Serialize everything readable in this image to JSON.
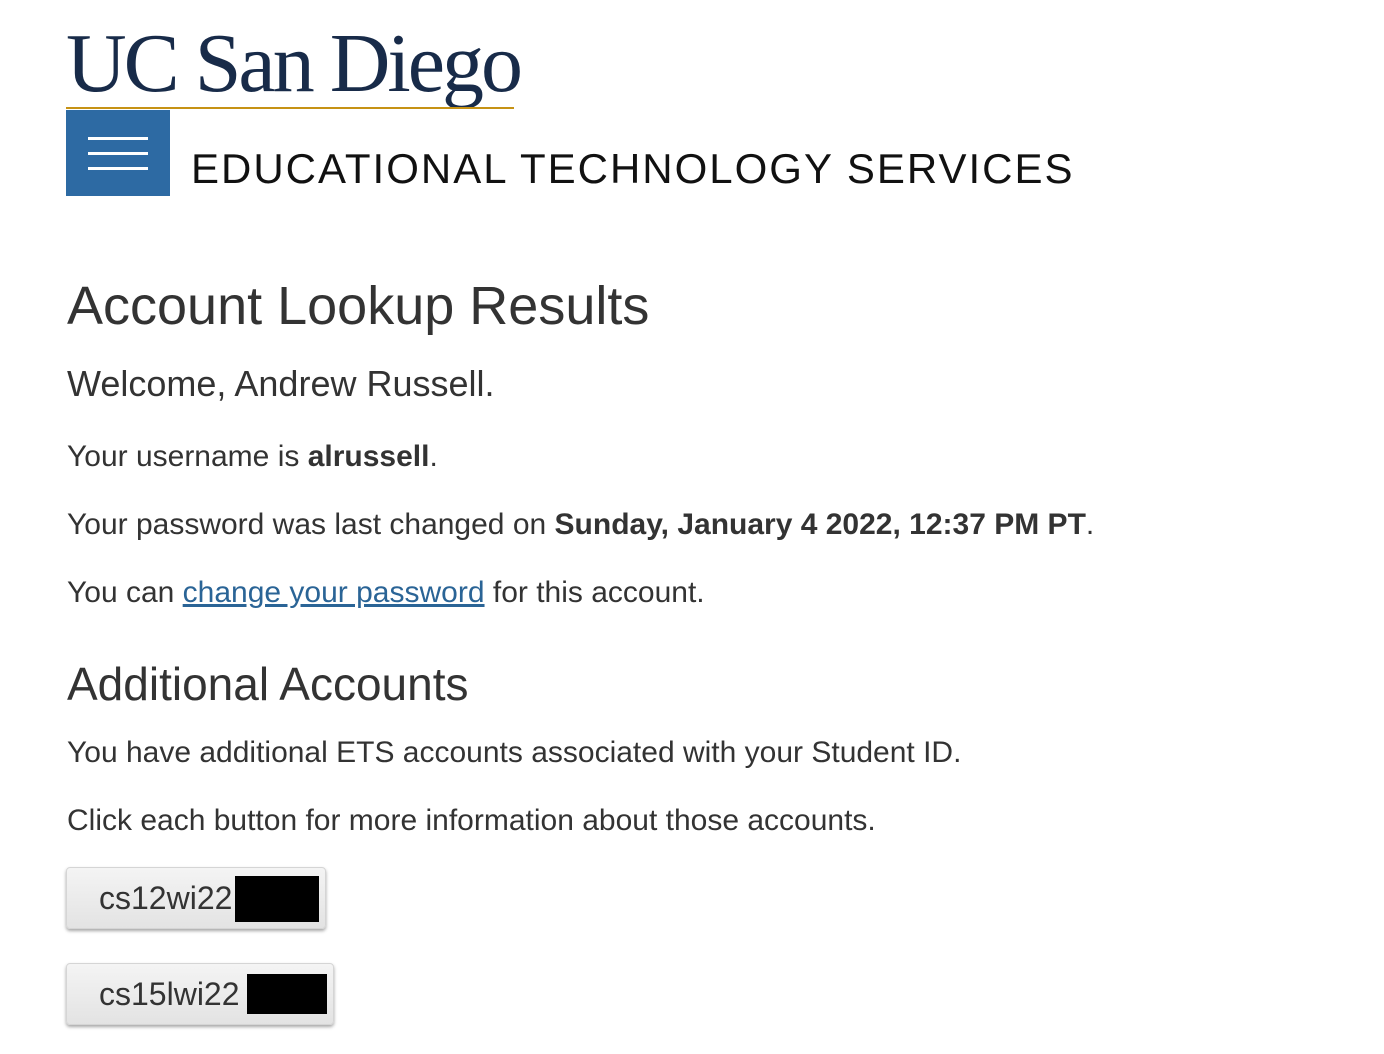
{
  "header": {
    "logo_text": "UC San Diego",
    "department": "EDUCATIONAL TECHNOLOGY SERVICES"
  },
  "main": {
    "title": "Account Lookup Results",
    "welcome": "Welcome, Andrew Russell.",
    "username_prefix": "Your username is ",
    "username": "alrussell",
    "username_suffix": ".",
    "password_prefix": "Your password was last changed on ",
    "password_changed": "Sunday, January 4 2022, 12:37 PM PT",
    "password_suffix": ".",
    "change_prefix": "You can ",
    "change_link": "change your password",
    "change_suffix": " for this account."
  },
  "additional": {
    "title": "Additional Accounts",
    "line1": "You have additional ETS accounts associated with your Student ID.",
    "line2": "Click each button for more information about those accounts.",
    "accounts": [
      {
        "label": "cs12wi22"
      },
      {
        "label": "cs15lwi22"
      }
    ]
  }
}
